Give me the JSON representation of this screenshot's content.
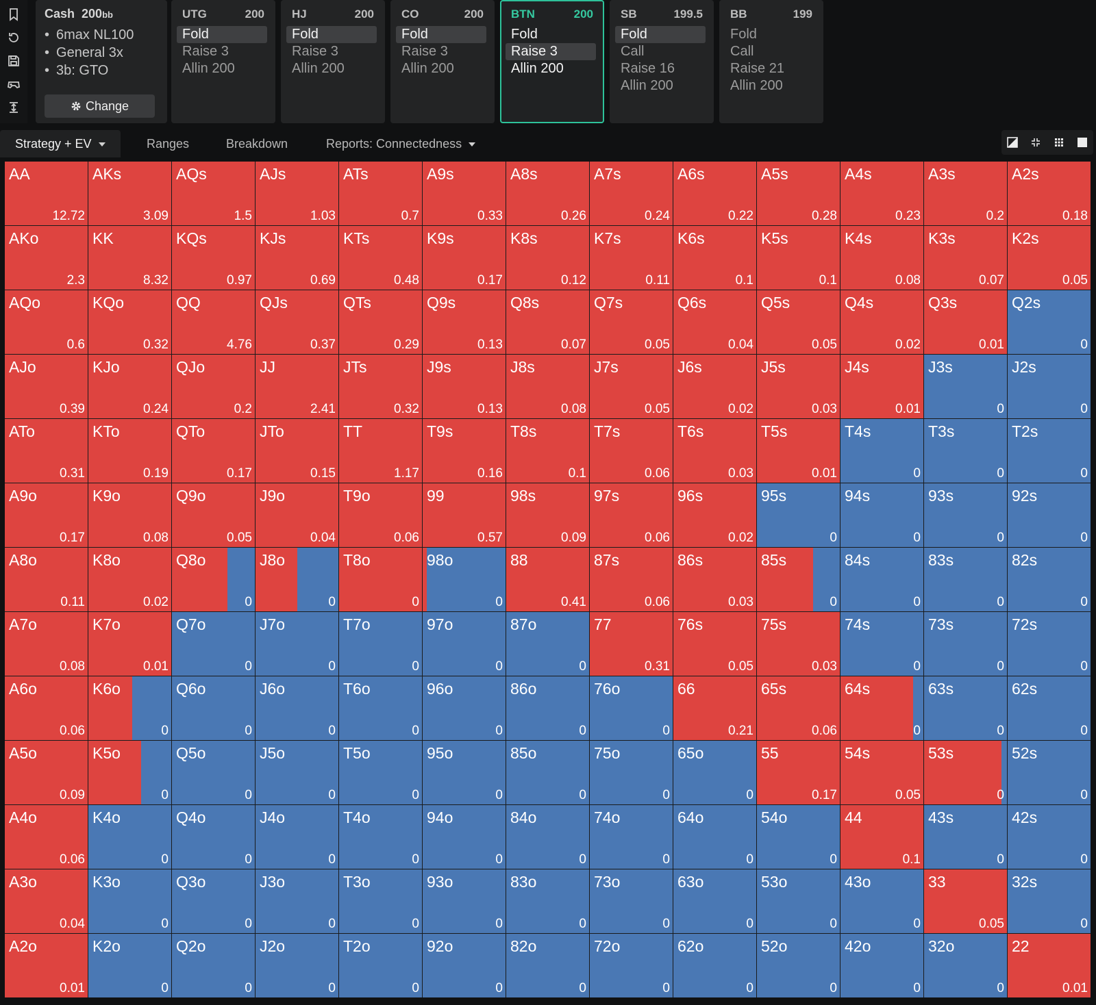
{
  "icons": [
    "bookmark-icon",
    "history-icon",
    "save-icon",
    "gamepad-icon",
    "height-icon"
  ],
  "settings": {
    "title": "Cash",
    "stack": "200",
    "unit": "bb",
    "items": [
      "6max NL100",
      "General 3x",
      "3b: GTO"
    ],
    "button_label": "Change"
  },
  "positions": [
    {
      "name": "UTG",
      "stack": "200",
      "active": false,
      "actions": [
        {
          "label": "Fold",
          "selected": true
        },
        {
          "label": "Raise 3",
          "selected": false
        },
        {
          "label": "Allin 200",
          "selected": false
        }
      ]
    },
    {
      "name": "HJ",
      "stack": "200",
      "active": false,
      "actions": [
        {
          "label": "Fold",
          "selected": true
        },
        {
          "label": "Raise 3",
          "selected": false
        },
        {
          "label": "Allin 200",
          "selected": false
        }
      ]
    },
    {
      "name": "CO",
      "stack": "200",
      "active": false,
      "actions": [
        {
          "label": "Fold",
          "selected": true
        },
        {
          "label": "Raise 3",
          "selected": false
        },
        {
          "label": "Allin 200",
          "selected": false
        }
      ]
    },
    {
      "name": "BTN",
      "stack": "200",
      "active": true,
      "actions": [
        {
          "label": "Fold",
          "selected": false
        },
        {
          "label": "Raise 3",
          "selected": true
        },
        {
          "label": "Allin 200",
          "selected": false
        }
      ]
    },
    {
      "name": "SB",
      "stack": "199.5",
      "active": false,
      "actions": [
        {
          "label": "Fold",
          "selected": true
        },
        {
          "label": "Call",
          "selected": false
        },
        {
          "label": "Raise 16",
          "selected": false
        },
        {
          "label": "Allin 200",
          "selected": false
        }
      ]
    },
    {
      "name": "BB",
      "stack": "199",
      "active": false,
      "actions": [
        {
          "label": "Fold",
          "selected": false
        },
        {
          "label": "Call",
          "selected": false
        },
        {
          "label": "Raise 21",
          "selected": false
        },
        {
          "label": "Allin 200",
          "selected": false
        }
      ]
    }
  ],
  "tabs": [
    {
      "label": "Strategy + EV",
      "dropdown": true,
      "active": true
    },
    {
      "label": "Ranges",
      "dropdown": false,
      "active": false
    },
    {
      "label": "Breakdown",
      "dropdown": false,
      "active": false
    },
    {
      "label": "Reports: Connectedness",
      "dropdown": true,
      "active": false
    }
  ],
  "view_buttons": [
    "contrast-icon",
    "compress-icon",
    "grid-icon",
    "square-icon"
  ],
  "colors": {
    "raise": "#de4440",
    "fold": "#4a78b4",
    "active_accent": "#2ec29a"
  },
  "matrix": {
    "rows": [
      [
        [
          "AA",
          "12.72",
          1
        ],
        [
          "AKs",
          "3.09",
          1
        ],
        [
          "AQs",
          "1.5",
          1
        ],
        [
          "AJs",
          "1.03",
          1
        ],
        [
          "ATs",
          "0.7",
          1
        ],
        [
          "A9s",
          "0.33",
          1
        ],
        [
          "A8s",
          "0.26",
          1
        ],
        [
          "A7s",
          "0.24",
          1
        ],
        [
          "A6s",
          "0.22",
          1
        ],
        [
          "A5s",
          "0.28",
          1
        ],
        [
          "A4s",
          "0.23",
          1
        ],
        [
          "A3s",
          "0.2",
          1
        ],
        [
          "A2s",
          "0.18",
          1
        ]
      ],
      [
        [
          "AKo",
          "2.3",
          1
        ],
        [
          "KK",
          "8.32",
          1
        ],
        [
          "KQs",
          "0.97",
          1
        ],
        [
          "KJs",
          "0.69",
          1
        ],
        [
          "KTs",
          "0.48",
          1
        ],
        [
          "K9s",
          "0.17",
          1
        ],
        [
          "K8s",
          "0.12",
          1
        ],
        [
          "K7s",
          "0.11",
          1
        ],
        [
          "K6s",
          "0.1",
          1
        ],
        [
          "K5s",
          "0.1",
          1
        ],
        [
          "K4s",
          "0.08",
          1
        ],
        [
          "K3s",
          "0.07",
          1
        ],
        [
          "K2s",
          "0.05",
          1
        ]
      ],
      [
        [
          "AQo",
          "0.6",
          1
        ],
        [
          "KQo",
          "0.32",
          1
        ],
        [
          "QQ",
          "4.76",
          1
        ],
        [
          "QJs",
          "0.37",
          1
        ],
        [
          "QTs",
          "0.29",
          1
        ],
        [
          "Q9s",
          "0.13",
          1
        ],
        [
          "Q8s",
          "0.07",
          1
        ],
        [
          "Q7s",
          "0.05",
          1
        ],
        [
          "Q6s",
          "0.04",
          1
        ],
        [
          "Q5s",
          "0.05",
          1
        ],
        [
          "Q4s",
          "0.02",
          1
        ],
        [
          "Q3s",
          "0.01",
          1
        ],
        [
          "Q2s",
          "0",
          0
        ]
      ],
      [
        [
          "AJo",
          "0.39",
          1
        ],
        [
          "KJo",
          "0.24",
          1
        ],
        [
          "QJo",
          "0.2",
          1
        ],
        [
          "JJ",
          "2.41",
          1
        ],
        [
          "JTs",
          "0.32",
          1
        ],
        [
          "J9s",
          "0.13",
          1
        ],
        [
          "J8s",
          "0.08",
          1
        ],
        [
          "J7s",
          "0.05",
          1
        ],
        [
          "J6s",
          "0.02",
          1
        ],
        [
          "J5s",
          "0.03",
          1
        ],
        [
          "J4s",
          "0.01",
          1
        ],
        [
          "J3s",
          "0",
          0
        ],
        [
          "J2s",
          "0",
          0
        ]
      ],
      [
        [
          "ATo",
          "0.31",
          1
        ],
        [
          "KTo",
          "0.19",
          1
        ],
        [
          "QTo",
          "0.17",
          1
        ],
        [
          "JTo",
          "0.15",
          1
        ],
        [
          "TT",
          "1.17",
          1
        ],
        [
          "T9s",
          "0.16",
          1
        ],
        [
          "T8s",
          "0.1",
          1
        ],
        [
          "T7s",
          "0.06",
          1
        ],
        [
          "T6s",
          "0.03",
          1
        ],
        [
          "T5s",
          "0.01",
          1
        ],
        [
          "T4s",
          "0",
          0
        ],
        [
          "T3s",
          "0",
          0
        ],
        [
          "T2s",
          "0",
          0
        ]
      ],
      [
        [
          "A9o",
          "0.17",
          1
        ],
        [
          "K9o",
          "0.08",
          1
        ],
        [
          "Q9o",
          "0.05",
          1
        ],
        [
          "J9o",
          "0.04",
          1
        ],
        [
          "T9o",
          "0.06",
          1
        ],
        [
          "99",
          "0.57",
          1
        ],
        [
          "98s",
          "0.09",
          1
        ],
        [
          "97s",
          "0.06",
          1
        ],
        [
          "96s",
          "0.02",
          1
        ],
        [
          "95s",
          "0",
          0
        ],
        [
          "94s",
          "0",
          0
        ],
        [
          "93s",
          "0",
          0
        ],
        [
          "92s",
          "0",
          0
        ]
      ],
      [
        [
          "A8o",
          "0.11",
          1
        ],
        [
          "K8o",
          "0.02",
          1
        ],
        [
          "Q8o",
          "0",
          0.67
        ],
        [
          "J8o",
          "0",
          0.5
        ],
        [
          "T8o",
          "0",
          1
        ],
        [
          "98o",
          "0",
          0.05
        ],
        [
          "88",
          "0.41",
          1
        ],
        [
          "87s",
          "0.06",
          1
        ],
        [
          "86s",
          "0.03",
          1
        ],
        [
          "85s",
          "0",
          0.68
        ],
        [
          "84s",
          "0",
          0
        ],
        [
          "83s",
          "0",
          0
        ],
        [
          "82s",
          "0",
          0
        ]
      ],
      [
        [
          "A7o",
          "0.08",
          1
        ],
        [
          "K7o",
          "0.01",
          1
        ],
        [
          "Q7o",
          "0",
          0
        ],
        [
          "J7o",
          "0",
          0
        ],
        [
          "T7o",
          "0",
          0
        ],
        [
          "97o",
          "0",
          0
        ],
        [
          "87o",
          "0",
          0
        ],
        [
          "77",
          "0.31",
          1
        ],
        [
          "76s",
          "0.05",
          1
        ],
        [
          "75s",
          "0.03",
          1
        ],
        [
          "74s",
          "0",
          0
        ],
        [
          "73s",
          "0",
          0
        ],
        [
          "72s",
          "0",
          0
        ]
      ],
      [
        [
          "A6o",
          "0.06",
          1
        ],
        [
          "K6o",
          "0",
          0.53
        ],
        [
          "Q6o",
          "0",
          0
        ],
        [
          "J6o",
          "0",
          0
        ],
        [
          "T6o",
          "0",
          0
        ],
        [
          "96o",
          "0",
          0
        ],
        [
          "86o",
          "0",
          0
        ],
        [
          "76o",
          "0",
          0
        ],
        [
          "66",
          "0.21",
          1
        ],
        [
          "65s",
          "0.06",
          1
        ],
        [
          "64s",
          "0",
          0.88
        ],
        [
          "63s",
          "0",
          0
        ],
        [
          "62s",
          "0",
          0
        ]
      ],
      [
        [
          "A5o",
          "0.09",
          1
        ],
        [
          "K5o",
          "0",
          0.64
        ],
        [
          "Q5o",
          "0",
          0
        ],
        [
          "J5o",
          "0",
          0
        ],
        [
          "T5o",
          "0",
          0
        ],
        [
          "95o",
          "0",
          0
        ],
        [
          "85o",
          "0",
          0
        ],
        [
          "75o",
          "0",
          0
        ],
        [
          "65o",
          "0",
          0
        ],
        [
          "55",
          "0.17",
          1
        ],
        [
          "54s",
          "0.05",
          1
        ],
        [
          "53s",
          "0",
          0.93
        ],
        [
          "52s",
          "0",
          0
        ]
      ],
      [
        [
          "A4o",
          "0.06",
          1
        ],
        [
          "K4o",
          "0",
          0
        ],
        [
          "Q4o",
          "0",
          0
        ],
        [
          "J4o",
          "0",
          0
        ],
        [
          "T4o",
          "0",
          0
        ],
        [
          "94o",
          "0",
          0
        ],
        [
          "84o",
          "0",
          0
        ],
        [
          "74o",
          "0",
          0
        ],
        [
          "64o",
          "0",
          0
        ],
        [
          "54o",
          "0",
          0
        ],
        [
          "44",
          "0.1",
          1
        ],
        [
          "43s",
          "0",
          0
        ],
        [
          "42s",
          "0",
          0
        ]
      ],
      [
        [
          "A3o",
          "0.04",
          1
        ],
        [
          "K3o",
          "0",
          0
        ],
        [
          "Q3o",
          "0",
          0
        ],
        [
          "J3o",
          "0",
          0
        ],
        [
          "T3o",
          "0",
          0
        ],
        [
          "93o",
          "0",
          0
        ],
        [
          "83o",
          "0",
          0
        ],
        [
          "73o",
          "0",
          0
        ],
        [
          "63o",
          "0",
          0
        ],
        [
          "53o",
          "0",
          0
        ],
        [
          "43o",
          "0",
          0
        ],
        [
          "33",
          "0.05",
          1
        ],
        [
          "32s",
          "0",
          0
        ]
      ],
      [
        [
          "A2o",
          "0.01",
          1
        ],
        [
          "K2o",
          "0",
          0
        ],
        [
          "Q2o",
          "0",
          0
        ],
        [
          "J2o",
          "0",
          0
        ],
        [
          "T2o",
          "0",
          0
        ],
        [
          "92o",
          "0",
          0
        ],
        [
          "82o",
          "0",
          0
        ],
        [
          "72o",
          "0",
          0
        ],
        [
          "62o",
          "0",
          0
        ],
        [
          "52o",
          "0",
          0
        ],
        [
          "42o",
          "0",
          0
        ],
        [
          "32o",
          "0",
          0
        ],
        [
          "22",
          "0.01",
          1
        ]
      ]
    ]
  }
}
